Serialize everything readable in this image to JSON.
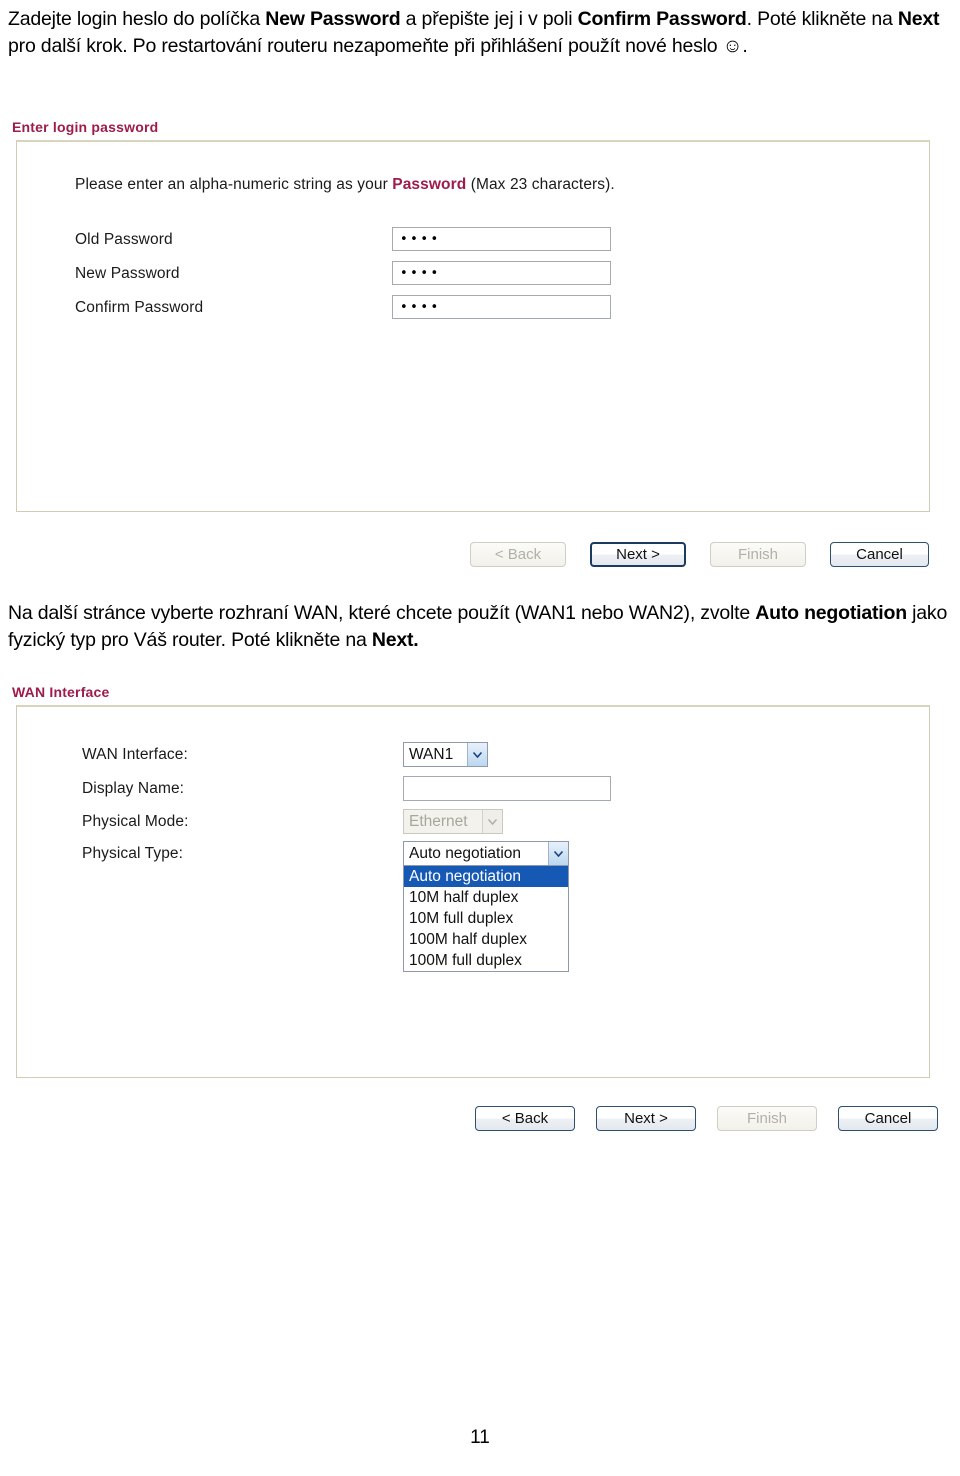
{
  "document": {
    "page_number": "11"
  },
  "intro_text": {
    "line_prefix_1": "Zadejte login heslo do políčka ",
    "bold_1": "New Password",
    "mid_1": " a přepište jej i v poli ",
    "bold_2": "Confirm Password",
    "mid_2": ". Poté klikněte na ",
    "bold_3": "Next",
    "tail": " pro další krok. Po restartování routeru nezapomeňte při přihlášení použít nové heslo ☺."
  },
  "middle_text": {
    "prefix": "Na další stránce vyberte rozhraní WAN, které chcete použít (WAN1 nebo WAN2), zvolte ",
    "bold_1": "Auto negotiation",
    "mid": " jako fyzický typ pro Váš router. Poté klikněte na ",
    "bold_2": "Next."
  },
  "panel_password": {
    "heading": "Enter login password",
    "note_prefix": "Please enter an alpha-numeric string as your ",
    "note_highlight": "Password",
    "note_suffix": " (Max 23 characters).",
    "fields": [
      {
        "label": "Old Password",
        "value": "••••"
      },
      {
        "label": "New Password",
        "value": "••••"
      },
      {
        "label": "Confirm Password",
        "value": "••••"
      }
    ],
    "buttons": [
      {
        "label": "< Back",
        "state": "disabled"
      },
      {
        "label": "Next >",
        "state": "focused"
      },
      {
        "label": "Finish",
        "state": "disabled"
      },
      {
        "label": "Cancel",
        "state": "enabled"
      }
    ]
  },
  "panel_wan": {
    "heading": "WAN Interface",
    "labels": {
      "wan_interface": "WAN Interface:",
      "display_name": "Display Name:",
      "physical_mode": "Physical Mode:",
      "physical_type": "Physical Type:"
    },
    "wan_interface_value": "WAN1",
    "display_name_value": "",
    "physical_mode_value": "Ethernet",
    "physical_type_value": "Auto negotiation",
    "physical_type_options": [
      "Auto negotiation",
      "10M half duplex",
      "10M full duplex",
      "100M half duplex",
      "100M full duplex"
    ],
    "physical_type_selected_index": 0,
    "buttons": [
      {
        "label": "< Back",
        "state": "enabled"
      },
      {
        "label": "Next >",
        "state": "enabled"
      },
      {
        "label": "Finish",
        "state": "disabled"
      },
      {
        "label": "Cancel",
        "state": "enabled"
      }
    ]
  },
  "colors": {
    "heading": "#9e1b4b",
    "panel_border": "#cfcbb4",
    "selected_option": "#1559b5",
    "button_border": "#2e4f72"
  }
}
